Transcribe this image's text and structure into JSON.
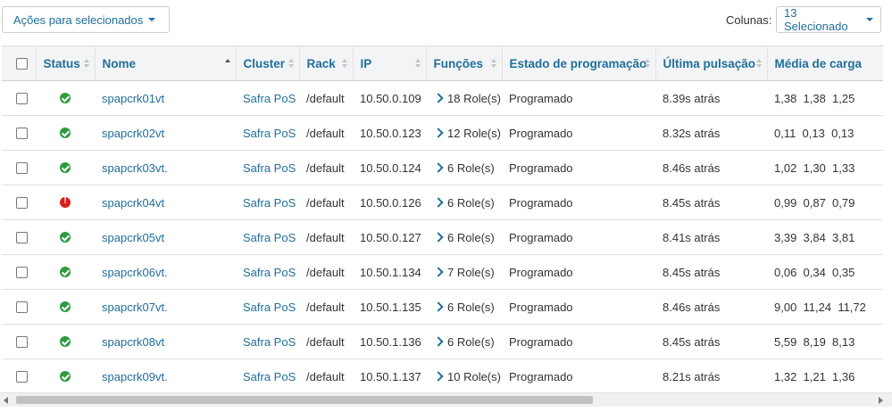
{
  "toolbar": {
    "actions_label": "Ações para selecionados",
    "columns_label": "Colunas:",
    "columns_selected": "13 Selecionado"
  },
  "columns": [
    "Status",
    "Nome",
    "Cluster",
    "Rack",
    "IP",
    "Funções",
    "Estado de programação",
    "Última pulsação",
    "Média de carga"
  ],
  "sort": {
    "column": "Nome",
    "direction": "ascending"
  },
  "rows": [
    {
      "status": "ok",
      "name": "spapcrk01vt",
      "cluster": "Safra PoS",
      "rack": "/default",
      "ip": "10.50.0.109",
      "roles": "18 Role(s)",
      "state": "Programado",
      "heartbeat": "8.39s atrás",
      "load": "1,38  1,38  1,25"
    },
    {
      "status": "ok",
      "name": "spapcrk02vt",
      "cluster": "Safra PoS",
      "rack": "/default",
      "ip": "10.50.0.123",
      "roles": "12 Role(s)",
      "state": "Programado",
      "heartbeat": "8.32s atrás",
      "load": "0,11  0,13  0,13"
    },
    {
      "status": "ok",
      "name": "spapcrk03vt.",
      "cluster": "Safra PoS",
      "rack": "/default",
      "ip": "10.50.0.124",
      "roles": "6 Role(s)",
      "state": "Programado",
      "heartbeat": "8.46s atrás",
      "load": "1,02  1,30  1,33"
    },
    {
      "status": "error",
      "name": "spapcrk04vt",
      "cluster": "Safra PoS",
      "rack": "/default",
      "ip": "10.50.0.126",
      "roles": "6 Role(s)",
      "state": "Programado",
      "heartbeat": "8.45s atrás",
      "load": "0,99  0,87  0,79"
    },
    {
      "status": "ok",
      "name": "spapcrk05vt",
      "cluster": "Safra PoS",
      "rack": "/default",
      "ip": "10.50.0.127",
      "roles": "6 Role(s)",
      "state": "Programado",
      "heartbeat": "8.41s atrás",
      "load": "3,39  3,84  3,81"
    },
    {
      "status": "ok",
      "name": "spapcrk06vt.",
      "cluster": "Safra PoS",
      "rack": "/default",
      "ip": "10.50.1.134",
      "roles": "7 Role(s)",
      "state": "Programado",
      "heartbeat": "8.45s atrás",
      "load": "0,06  0,34  0,35"
    },
    {
      "status": "ok",
      "name": "spapcrk07vt.",
      "cluster": "Safra PoS",
      "rack": "/default",
      "ip": "10.50.1.135",
      "roles": "6 Role(s)",
      "state": "Programado",
      "heartbeat": "8.46s atrás",
      "load": "9,00  11,24  11,72"
    },
    {
      "status": "ok",
      "name": "spapcrk08vt",
      "cluster": "Safra PoS",
      "rack": "/default",
      "ip": "10.50.1.136",
      "roles": "6 Role(s)",
      "state": "Programado",
      "heartbeat": "8.45s atrás",
      "load": "5,59  8,19  8,13"
    },
    {
      "status": "ok",
      "name": "spapcrk09vt.",
      "cluster": "Safra PoS",
      "rack": "/default",
      "ip": "10.50.1.137",
      "roles": "10 Role(s)",
      "state": "Programado",
      "heartbeat": "8.21s atrás",
      "load": "1,32  1,21  1,36"
    }
  ],
  "colors": {
    "link": "#1f6f9a",
    "ok": "#2e9a3e",
    "error": "#d81e1e",
    "header_bg": "#f3f4f6"
  },
  "icons": {
    "ok": "check-circle-icon",
    "error": "exclamation-circle-icon",
    "sort": "sort-icon",
    "expand": "chevron-right-icon"
  }
}
